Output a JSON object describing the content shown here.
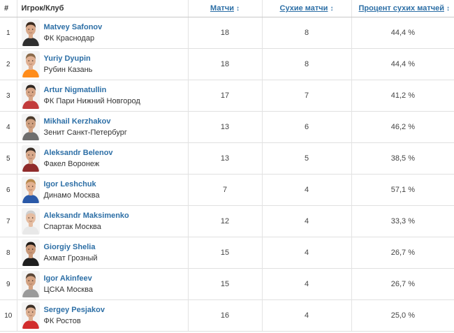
{
  "table": {
    "headers": {
      "rank": "#",
      "player": "Игрок/Клуб",
      "games": "Матчи",
      "clean_sheets": "Сухие матчи",
      "percent": "Процент сухих матчей",
      "sort_icon": "sort-arrows-icon"
    },
    "rows": [
      {
        "rank": "1",
        "name": "Matvey Safonov",
        "club": "ФК Краснодар",
        "games": "18",
        "clean_sheets": "8",
        "percent": "44,4 %",
        "skin": "#d9a98a",
        "hair": "#3b2a1e",
        "shirt": "#2f2f2f"
      },
      {
        "rank": "2",
        "name": "Yuriy Dyupin",
        "club": "Рубин Казань",
        "games": "18",
        "clean_sheets": "8",
        "percent": "44,4 %",
        "skin": "#e0b092",
        "hair": "#8a6a4a",
        "shirt": "#ff8c1a"
      },
      {
        "rank": "3",
        "name": "Artur Nigmatullin",
        "club": "ФК Пари Нижний Новгород",
        "games": "17",
        "clean_sheets": "7",
        "percent": "41,2 %",
        "skin": "#d7a586",
        "hair": "#2e2620",
        "shirt": "#c23b3b"
      },
      {
        "rank": "4",
        "name": "Mikhail Kerzhakov",
        "club": "Зенит Санкт-Петербург",
        "games": "13",
        "clean_sheets": "6",
        "percent": "46,2 %",
        "skin": "#cfa080",
        "hair": "#4a3a2c",
        "shirt": "#6e6e6e"
      },
      {
        "rank": "5",
        "name": "Aleksandr Belenov",
        "club": "Факел Воронеж",
        "games": "13",
        "clean_sheets": "5",
        "percent": "38,5 %",
        "skin": "#d8a88a",
        "hair": "#3a2e26",
        "shirt": "#8f2a2a"
      },
      {
        "rank": "6",
        "name": "Igor Leshchuk",
        "club": "Динамо Москва",
        "games": "7",
        "clean_sheets": "4",
        "percent": "57,1 %",
        "skin": "#e2b191",
        "hair": "#b8894e",
        "shirt": "#2a59a8"
      },
      {
        "rank": "7",
        "name": "Aleksandr Maksimenko",
        "club": "Спартак Москва",
        "games": "12",
        "clean_sheets": "4",
        "percent": "33,3 %",
        "skin": "#e5bca0",
        "hair": "#cfcfcf",
        "shirt": "#e8e8e8"
      },
      {
        "rank": "8",
        "name": "Giorgiy Shelia",
        "club": "Ахмат Грозный",
        "games": "15",
        "clean_sheets": "4",
        "percent": "26,7 %",
        "skin": "#c99878",
        "hair": "#1f1a16",
        "shirt": "#1e1e1e"
      },
      {
        "rank": "9",
        "name": "Igor Akinfeev",
        "club": "ЦСКА Москва",
        "games": "15",
        "clean_sheets": "4",
        "percent": "26,7 %",
        "skin": "#d3a282",
        "hair": "#5a4636",
        "shirt": "#9a9a9a"
      },
      {
        "rank": "10",
        "name": "Sergey Pesjakov",
        "club": "ФК Ростов",
        "games": "16",
        "clean_sheets": "4",
        "percent": "25,0 %",
        "skin": "#dcae90",
        "hair": "#3a2e24",
        "shirt": "#d12c2c"
      }
    ]
  }
}
